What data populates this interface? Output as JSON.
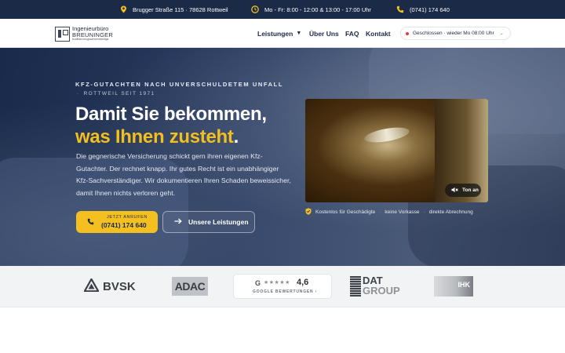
{
  "topbar": {
    "address": "Brugger Straße 115 · 78628 Rottweil",
    "hours": "Mo - Fr: 8:00 - 12:00 & 13:00 - 17:00 Uhr",
    "phone": "(0741) 174 640"
  },
  "logo": {
    "line1": "Ingenieurbüro",
    "line2": "BREUNINGER",
    "line3": "Kraftfahrzeugsachverständige"
  },
  "nav": {
    "items": [
      "Leistungen",
      "Über Uns",
      "FAQ",
      "Kontakt"
    ],
    "status": "Geschlossen · wieder Mo 08:00 Uhr"
  },
  "hero": {
    "eyebrow": "KFZ-GUTACHTEN NACH UNVERSCHULDETEM UNFALL",
    "eyebrow_sub": "ROTTWEIL SEIT 1971",
    "headline_white": "Damit Sie bekommen,",
    "headline_yellow": "was Ihnen zusteht",
    "headline_end": ".",
    "lead": "Die gegnerische Versicherung schickt gern ihren eigenen Kfz-Gutachter. Der rechnet knapp. Ihr gutes Recht ist ein unabhängiger Kfz-Sachverständiger. Wir dokumentieren Ihren Schaden beweissicher, damit Ihnen nichts verloren geht.",
    "cta_small": "JETZT ANRUFEN",
    "cta_phone": "(0741) 174 640",
    "secondary_cta": "Unsere Leistungen",
    "video_sound_label": "Ton an",
    "trust": [
      "Kostenlos für Geschädigte",
      "keine Vorkasse",
      "direkte Abrechnung"
    ]
  },
  "partners": {
    "bvsk": "BVSK",
    "adac": "ADAC",
    "google_letter": "G",
    "google_stars": "★★★★★",
    "google_rating": "4,6",
    "google_label": "GOOGLE BEWERTUNGEN ›",
    "dat_line1": "DAT",
    "dat_line2": "GROUP",
    "ihk": "IHK"
  },
  "colors": {
    "navy": "#1b2a47",
    "accent_yellow": "#f4c01f",
    "status_red": "#e53935"
  }
}
